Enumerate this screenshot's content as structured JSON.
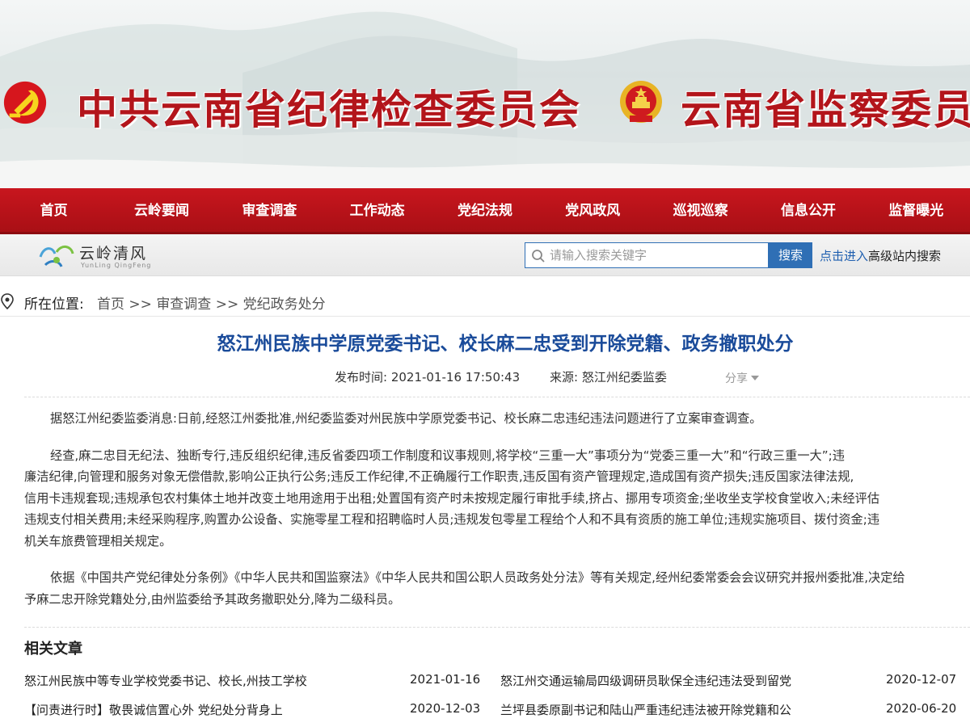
{
  "banner": {
    "title_left": "中共云南省纪律检查委员会",
    "title_right": "云南省监察委员会"
  },
  "nav": {
    "items": [
      "首页",
      "云岭要闻",
      "审查调查",
      "工作动态",
      "党纪法规",
      "党风政风",
      "巡视巡察",
      "信息公开",
      "监督曝光"
    ]
  },
  "logo": {
    "name": "云岭清风",
    "pinyin": "YunLing QingFeng"
  },
  "search": {
    "placeholder": "请输入搜索关键字",
    "button_label": "搜索",
    "advanced_link": "点击进入",
    "advanced_text": "高级站内搜索"
  },
  "breadcrumb": {
    "label": "所在位置:",
    "home": "首页",
    "sep1": ">>",
    "section": "审查调查",
    "sep2": ">>",
    "current": "党纪政务处分"
  },
  "article": {
    "title": "怒江州民族中学原党委书记、校长麻二忠受到开除党籍、政务撤职处分",
    "publish_time": "发布时间: 2021-01-16 17:50:43",
    "source": "来源: 怒江州纪委监委",
    "share_label": "分享",
    "paragraphs": [
      [
        "据怒江州纪委监委消息:日前,经怒江州委批准,州纪委监委对州民族中学原党委书记、校长麻二忠违纪违法问题进行了立案审查调查。"
      ],
      [
        "经查,麻二忠目无纪法、独断专行,违反组织纪律,违反省委四项工作制度和议事规则,将学校“三重一大”事项分为“党委三重一大”和“行政三重一大”;违",
        "廉洁纪律,向管理和服务对象无偿借款,影响公正执行公务;违反工作纪律,不正确履行工作职责,违反国有资产管理规定,造成国有资产损失;违反国家法律法规,",
        "信用卡违规套现;违规承包农村集体土地并改变土地用途用于出租;处置国有资产时未按规定履行审批手续,挤占、挪用专项资金;坐收坐支学校食堂收入;未经评估",
        "违规支付相关费用;未经采购程序,购置办公设备、实施零星工程和招聘临时人员;违规发包零星工程给个人和不具有资质的施工单位;违规实施项目、拨付资金;违",
        "机关车旅费管理相关规定。"
      ],
      [
        "依据《中国共产党纪律处分条例》《中华人民共和国监察法》《中华人民共和国公职人员政务处分法》等有关规定,经州纪委常委会会议研究并报州委批准,决定给",
        "予麻二忠开除党籍处分,由州监委给予其政务撤职处分,降为二级科员。"
      ]
    ]
  },
  "related": {
    "title": "相关文章",
    "items": [
      {
        "title": "怒江州民族中等专业学校党委书记、校长,州技工学校",
        "date": "2021-01-16"
      },
      {
        "title": "怒江州交通运输局四级调研员耿保全违纪违法受到留党",
        "date": "2020-12-07"
      },
      {
        "title": "【问责进行时】敬畏诚信置心外 党纪处分背身上",
        "date": "2020-12-03"
      },
      {
        "title": "兰坪县委原副书记和陆山严重违纪违法被开除党籍和公",
        "date": "2020-06-20"
      }
    ]
  },
  "colors": {
    "nav_red": "#b3131a",
    "title_blue": "#1a4b9a",
    "search_blue": "#2f6fb5",
    "banner_red": "#b3151b"
  }
}
